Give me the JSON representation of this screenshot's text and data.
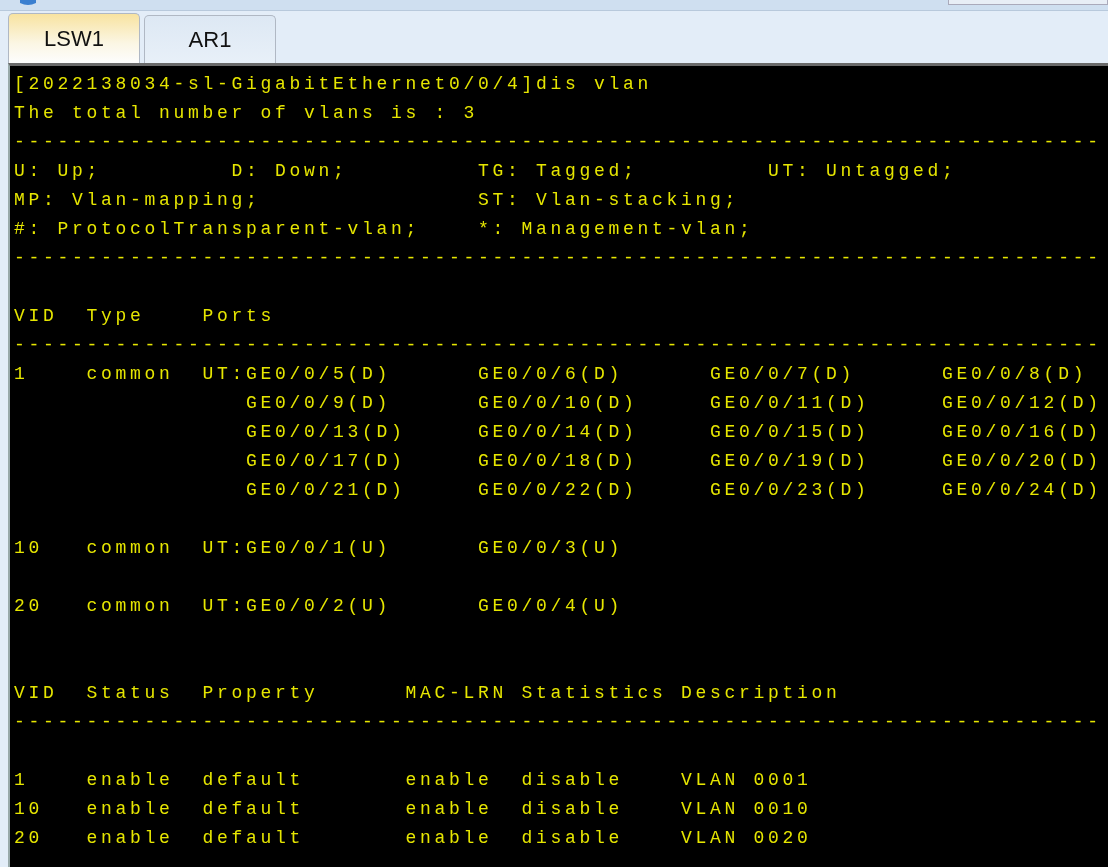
{
  "tabs": [
    {
      "label": "LSW1",
      "selected": true
    },
    {
      "label": "AR1",
      "selected": false
    }
  ],
  "terminal": {
    "lines": [
      {
        "kind": "text",
        "text": "[2022138034-sl-GigabitEthernet0/0/4]dis vlan"
      },
      {
        "kind": "text",
        "text": "The total number of vlans is : 3"
      },
      {
        "kind": "text",
        "text": "---------------------------------------------------------------------------"
      },
      {
        "kind": "text",
        "text": "U: Up;         D: Down;         TG: Tagged;         UT: Untagged;"
      },
      {
        "kind": "text",
        "text": "MP: Vlan-mapping;               ST: Vlan-stacking;"
      },
      {
        "kind": "text",
        "text": "#: ProtocolTransparent-vlan;    *: Management-vlan;"
      },
      {
        "kind": "text",
        "text": "---------------------------------------------------------------------------"
      },
      {
        "kind": "blank"
      },
      {
        "kind": "text",
        "text": "VID  Type    Ports"
      },
      {
        "kind": "text",
        "text": "---------------------------------------------------------------------------"
      },
      {
        "kind": "text",
        "text": "1    common  UT:GE0/0/5(D)      GE0/0/6(D)      GE0/0/7(D)      GE0/0/8(D)"
      },
      {
        "kind": "text",
        "text": "                GE0/0/9(D)      GE0/0/10(D)     GE0/0/11(D)     GE0/0/12(D)"
      },
      {
        "kind": "text",
        "text": "                GE0/0/13(D)     GE0/0/14(D)     GE0/0/15(D)     GE0/0/16(D)"
      },
      {
        "kind": "text",
        "text": "                GE0/0/17(D)     GE0/0/18(D)     GE0/0/19(D)     GE0/0/20(D)"
      },
      {
        "kind": "text",
        "text": "                GE0/0/21(D)     GE0/0/22(D)     GE0/0/23(D)     GE0/0/24(D)"
      },
      {
        "kind": "blank"
      },
      {
        "kind": "text",
        "text": "10   common  UT:GE0/0/1(U)      GE0/0/3(U)"
      },
      {
        "kind": "blank"
      },
      {
        "kind": "text",
        "text": "20   common  UT:GE0/0/2(U)      GE0/0/4(U)"
      },
      {
        "kind": "blank"
      },
      {
        "kind": "blank"
      },
      {
        "kind": "text",
        "text": "VID  Status  Property      MAC-LRN Statistics Description"
      },
      {
        "kind": "text",
        "text": "---------------------------------------------------------------------------"
      },
      {
        "kind": "blank"
      },
      {
        "kind": "text",
        "text": "1    enable  default       enable  disable    VLAN 0001"
      },
      {
        "kind": "text",
        "text": "10   enable  default       enable  disable    VLAN 0010"
      },
      {
        "kind": "text",
        "text": "20   enable  default       enable  disable    VLAN 0020"
      }
    ]
  }
}
